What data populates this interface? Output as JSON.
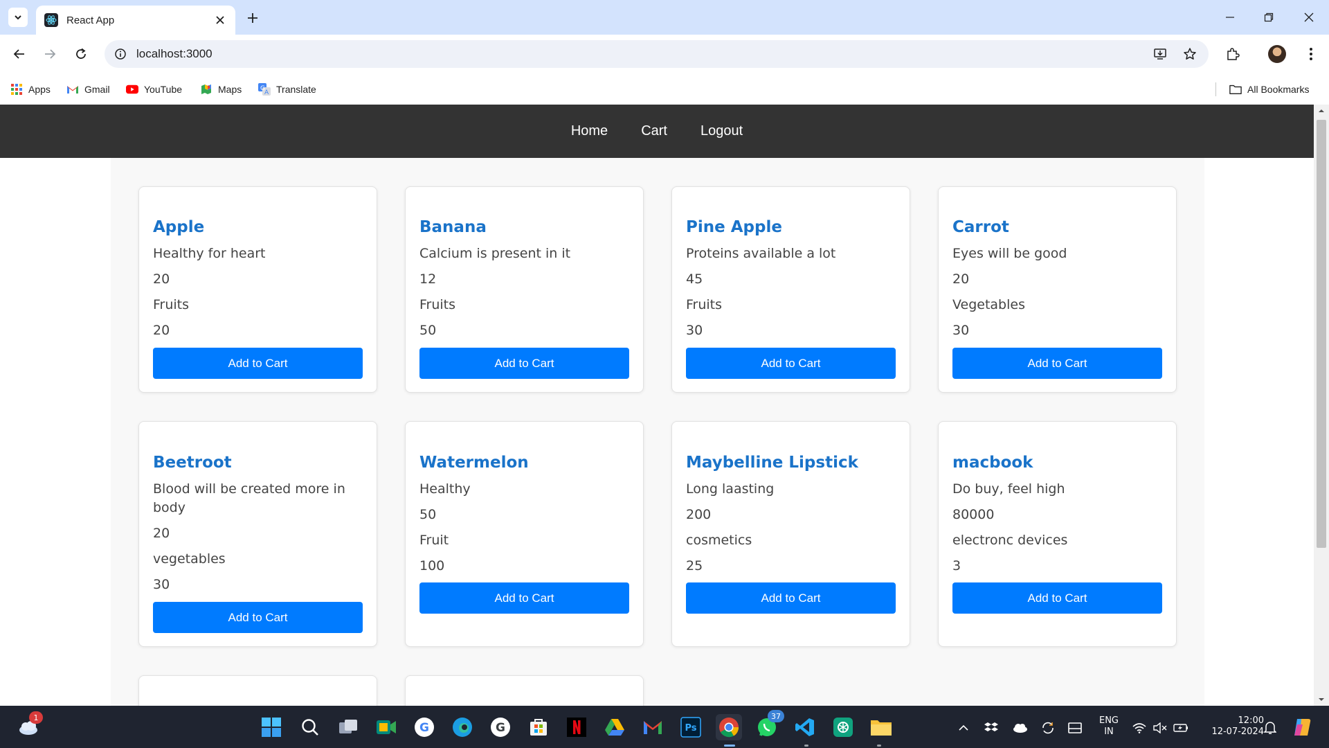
{
  "browser": {
    "tab_title": "React App",
    "url": "localhost:3000",
    "bookmarks": [
      "Apps",
      "Gmail",
      "YouTube",
      "Maps",
      "Translate"
    ],
    "all_bookmarks": "All Bookmarks"
  },
  "nav": {
    "links": [
      "Home",
      "Cart",
      "Logout"
    ]
  },
  "products": [
    {
      "name": "Apple",
      "description": "Healthy for heart",
      "price": "20",
      "category": "Fruits",
      "quantity": "20",
      "button": "Add to Cart"
    },
    {
      "name": "Banana",
      "description": "Calcium is present in it",
      "price": "12",
      "category": "Fruits",
      "quantity": "50",
      "button": "Add to Cart"
    },
    {
      "name": "Pine Apple",
      "description": "Proteins available a lot",
      "price": "45",
      "category": "Fruits",
      "quantity": "30",
      "button": "Add to Cart"
    },
    {
      "name": "Carrot",
      "description": "Eyes will be good",
      "price": "20",
      "category": "Vegetables",
      "quantity": "30",
      "button": "Add to Cart"
    },
    {
      "name": "Beetroot",
      "description": "Blood will be created more in body",
      "price": "20",
      "category": "vegetables",
      "quantity": "30",
      "button": "Add to Cart"
    },
    {
      "name": "Watermelon",
      "description": "Healthy",
      "price": "50",
      "category": "Fruit",
      "quantity": "100",
      "button": "Add to Cart"
    },
    {
      "name": "Maybelline Lipstick",
      "description": "Long laasting",
      "price": "200",
      "category": "cosmetics",
      "quantity": "25",
      "button": "Add to Cart"
    },
    {
      "name": "macbook",
      "description": "Do buy, feel high",
      "price": "80000",
      "category": "electronc devices",
      "quantity": "3",
      "button": "Add to Cart"
    }
  ],
  "taskbar": {
    "weather_badge": "1",
    "whatsapp_badge": "37",
    "language": "ENG",
    "region": "IN",
    "time": "12:00",
    "date": "12-07-2024"
  },
  "colors": {
    "navbar_bg": "#333333",
    "button_bg": "#007bff",
    "product_name": "#1a73c9"
  }
}
